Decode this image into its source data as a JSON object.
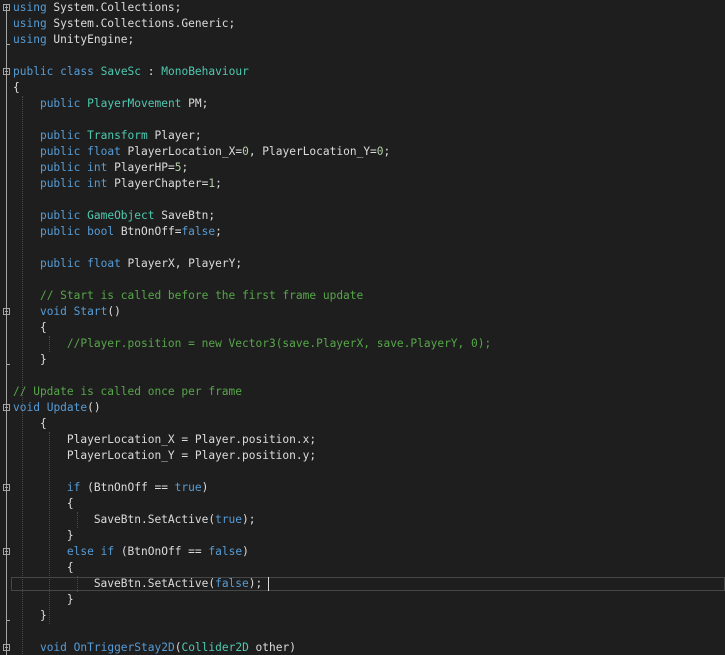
{
  "editor": {
    "language": "C#",
    "colors": {
      "background": "#1e1e1e",
      "keyword": "#569cd6",
      "type": "#4ec9b0",
      "comment": "#57a64a",
      "text": "#dcdcdc",
      "number": "#b5cea8"
    },
    "lines": [
      {
        "tokens": [
          [
            "kw",
            "using"
          ],
          [
            "id",
            " System.Collections;"
          ]
        ]
      },
      {
        "tokens": [
          [
            "kw",
            "using"
          ],
          [
            "id",
            " System.Collections.Generic;"
          ]
        ]
      },
      {
        "tokens": [
          [
            "kw",
            "using"
          ],
          [
            "id",
            " UnityEngine;"
          ]
        ]
      },
      {
        "tokens": []
      },
      {
        "tokens": [
          [
            "kw",
            "public"
          ],
          [
            "id",
            " "
          ],
          [
            "kw",
            "class"
          ],
          [
            "id",
            " "
          ],
          [
            "ty",
            "SaveSc"
          ],
          [
            "id",
            " : "
          ],
          [
            "ty",
            "MonoBehaviour"
          ]
        ]
      },
      {
        "tokens": [
          [
            "id",
            "{"
          ]
        ]
      },
      {
        "tokens": [
          [
            "id",
            "    "
          ],
          [
            "kw",
            "public"
          ],
          [
            "id",
            " "
          ],
          [
            "ty",
            "PlayerMovement"
          ],
          [
            "id",
            " PM;"
          ]
        ]
      },
      {
        "tokens": []
      },
      {
        "tokens": [
          [
            "id",
            "    "
          ],
          [
            "kw",
            "public"
          ],
          [
            "id",
            " "
          ],
          [
            "ty",
            "Transform"
          ],
          [
            "id",
            " Player;"
          ]
        ]
      },
      {
        "tokens": [
          [
            "id",
            "    "
          ],
          [
            "kw",
            "public"
          ],
          [
            "id",
            " "
          ],
          [
            "kw",
            "float"
          ],
          [
            "id",
            " PlayerLocation_X="
          ],
          [
            "nu",
            "0"
          ],
          [
            "id",
            ", PlayerLocation_Y="
          ],
          [
            "nu",
            "0"
          ],
          [
            "id",
            ";"
          ]
        ]
      },
      {
        "tokens": [
          [
            "id",
            "    "
          ],
          [
            "kw",
            "public"
          ],
          [
            "id",
            " "
          ],
          [
            "kw",
            "int"
          ],
          [
            "id",
            " PlayerHP="
          ],
          [
            "nu",
            "5"
          ],
          [
            "id",
            ";"
          ]
        ]
      },
      {
        "tokens": [
          [
            "id",
            "    "
          ],
          [
            "kw",
            "public"
          ],
          [
            "id",
            " "
          ],
          [
            "kw",
            "int"
          ],
          [
            "id",
            " PlayerChapter="
          ],
          [
            "nu",
            "1"
          ],
          [
            "id",
            ";"
          ]
        ]
      },
      {
        "tokens": []
      },
      {
        "tokens": [
          [
            "id",
            "    "
          ],
          [
            "kw",
            "public"
          ],
          [
            "id",
            " "
          ],
          [
            "ty",
            "GameObject"
          ],
          [
            "id",
            " SaveBtn;"
          ]
        ]
      },
      {
        "tokens": [
          [
            "id",
            "    "
          ],
          [
            "kw",
            "public"
          ],
          [
            "id",
            " "
          ],
          [
            "kw",
            "bool"
          ],
          [
            "id",
            " BtnOnOff="
          ],
          [
            "kw",
            "false"
          ],
          [
            "id",
            ";"
          ]
        ]
      },
      {
        "tokens": []
      },
      {
        "tokens": [
          [
            "id",
            "    "
          ],
          [
            "kw",
            "public"
          ],
          [
            "id",
            " "
          ],
          [
            "kw",
            "float"
          ],
          [
            "id",
            " PlayerX, PlayerY;"
          ]
        ]
      },
      {
        "tokens": []
      },
      {
        "tokens": [
          [
            "id",
            "    "
          ],
          [
            "cm",
            "// Start is called before the first frame update"
          ]
        ]
      },
      {
        "tokens": [
          [
            "id",
            "    "
          ],
          [
            "kw",
            "void"
          ],
          [
            "id",
            " "
          ],
          [
            "kw",
            "Start"
          ],
          [
            "id",
            "()"
          ]
        ]
      },
      {
        "tokens": [
          [
            "id",
            "    {"
          ]
        ]
      },
      {
        "tokens": [
          [
            "id",
            "        "
          ],
          [
            "cm",
            "//Player.position = new Vector3(save.PlayerX, save.PlayerY, 0);"
          ]
        ]
      },
      {
        "tokens": [
          [
            "id",
            "    }"
          ]
        ]
      },
      {
        "tokens": []
      },
      {
        "tokens": [
          [
            "cm",
            "// Update is called once per frame"
          ]
        ]
      },
      {
        "tokens": [
          [
            "kw",
            "void"
          ],
          [
            "id",
            " "
          ],
          [
            "kw",
            "Update"
          ],
          [
            "id",
            "()"
          ]
        ]
      },
      {
        "tokens": [
          [
            "id",
            "    {"
          ]
        ]
      },
      {
        "tokens": [
          [
            "id",
            "        PlayerLocation_X = Player.position.x;"
          ]
        ]
      },
      {
        "tokens": [
          [
            "id",
            "        PlayerLocation_Y = Player.position.y;"
          ]
        ]
      },
      {
        "tokens": []
      },
      {
        "tokens": [
          [
            "id",
            "        "
          ],
          [
            "kw",
            "if"
          ],
          [
            "id",
            " (BtnOnOff == "
          ],
          [
            "kw",
            "true"
          ],
          [
            "id",
            ")"
          ]
        ]
      },
      {
        "tokens": [
          [
            "id",
            "        {"
          ]
        ]
      },
      {
        "tokens": [
          [
            "id",
            "            SaveBtn.SetActive("
          ],
          [
            "kw",
            "true"
          ],
          [
            "id",
            ");"
          ]
        ]
      },
      {
        "tokens": [
          [
            "id",
            "        }"
          ]
        ]
      },
      {
        "tokens": [
          [
            "id",
            "        "
          ],
          [
            "kw",
            "else"
          ],
          [
            "id",
            " "
          ],
          [
            "kw",
            "if"
          ],
          [
            "id",
            " (BtnOnOff == "
          ],
          [
            "kw",
            "false"
          ],
          [
            "id",
            ")"
          ]
        ]
      },
      {
        "tokens": [
          [
            "id",
            "        {"
          ]
        ]
      },
      {
        "tokens": [
          [
            "id",
            "            SaveBtn.SetActive("
          ],
          [
            "kw",
            "false"
          ],
          [
            "id",
            ");"
          ]
        ]
      },
      {
        "tokens": [
          [
            "id",
            "        }"
          ]
        ]
      },
      {
        "tokens": [
          [
            "id",
            "    }"
          ]
        ]
      },
      {
        "tokens": []
      },
      {
        "tokens": [
          [
            "id",
            "    "
          ],
          [
            "kw",
            "void"
          ],
          [
            "id",
            " "
          ],
          [
            "kw",
            "OnTriggerStay2D"
          ],
          [
            "id",
            "("
          ],
          [
            "ty",
            "Collider2D"
          ],
          [
            "id",
            " other)"
          ]
        ]
      }
    ],
    "current_line": 36,
    "caret_after_text": true,
    "fold_markers": [
      0,
      4,
      19,
      25,
      30,
      34,
      40
    ]
  }
}
